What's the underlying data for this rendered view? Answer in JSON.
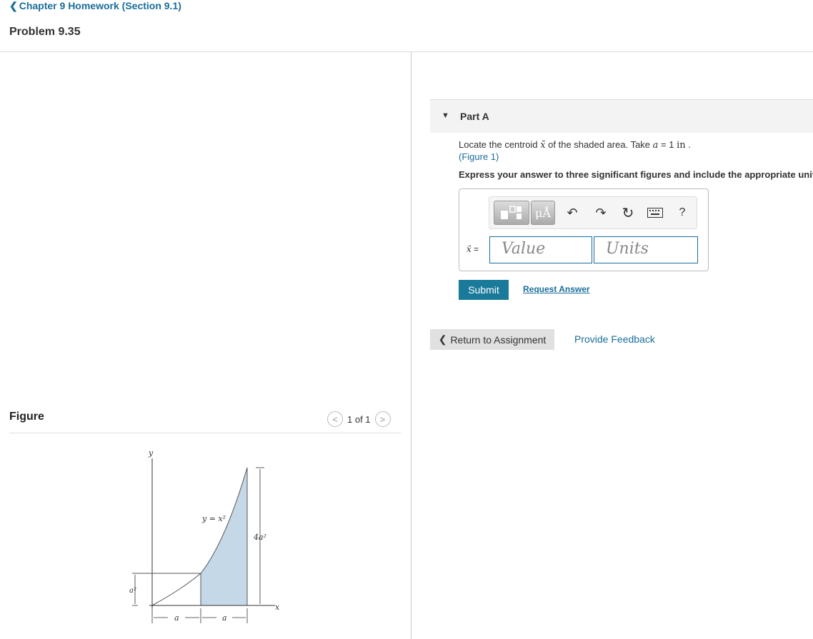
{
  "header": {
    "breadcrumb": "Chapter 9 Homework (Section 9.1)",
    "title": "Problem 9.35"
  },
  "figure_panel": {
    "label": "Figure",
    "pager_text": "1 of 1",
    "figure_labels": {
      "y_axis": "y",
      "x_axis": "x",
      "curve": "y = x²",
      "height": "4a²",
      "left_height": "a²",
      "dim_a1": "a",
      "dim_a2": "a"
    }
  },
  "part": {
    "label": "Part A",
    "question_pre": "Locate the centroid ",
    "question_symbol": "x̄",
    "question_mid": " of the shaded area. Take ",
    "question_var": "a",
    "question_eq": " = 1 ",
    "question_unit": "in",
    "question_end": " .",
    "figure_link": "(Figure 1)",
    "instruction": "Express your answer to three significant figures and include the appropriate units.",
    "answer_label_symbol": "x̄",
    "answer_label_eq": " =",
    "value_placeholder": "Value",
    "units_placeholder": "Units",
    "toolbar": {
      "units_button": "μÅ",
      "help": "?"
    },
    "submit_label": "Submit",
    "request_label": "Request Answer"
  },
  "footer": {
    "return_label": "Return to Assignment",
    "feedback_label": "Provide Feedback"
  }
}
